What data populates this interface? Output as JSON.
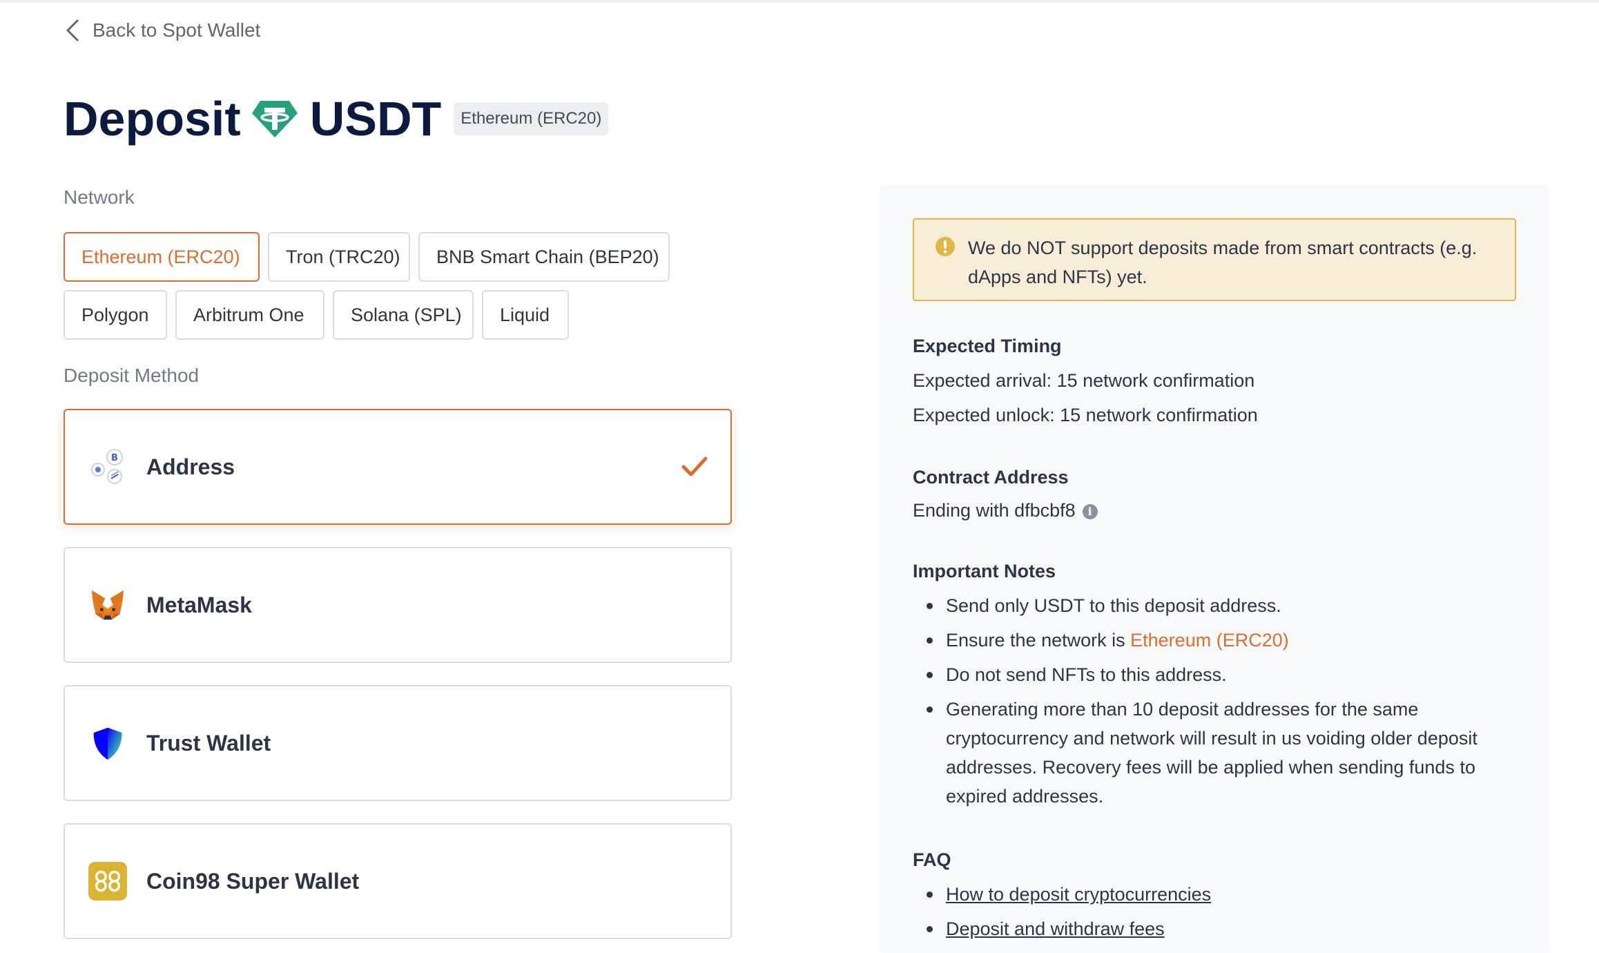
{
  "back": {
    "label": "Back to Spot Wallet"
  },
  "title": {
    "prefix": "Deposit",
    "coin": "USDT",
    "badge": "Ethereum (ERC20)"
  },
  "network": {
    "label": "Network",
    "options": [
      {
        "label": "Ethereum (ERC20)",
        "active": true
      },
      {
        "label": "Tron (TRC20)",
        "active": false
      },
      {
        "label": "BNB Smart Chain (BEP20)",
        "active": false
      },
      {
        "label": "Polygon",
        "active": false
      },
      {
        "label": "Arbitrum One",
        "active": false
      },
      {
        "label": "Solana (SPL)",
        "active": false
      },
      {
        "label": "Liquid",
        "active": false
      }
    ]
  },
  "deposit_method": {
    "label": "Deposit Method",
    "methods": [
      {
        "label": "Address",
        "icon": "address-coins-icon",
        "selected": true
      },
      {
        "label": "MetaMask",
        "icon": "metamask-fox-icon",
        "selected": false
      },
      {
        "label": "Trust Wallet",
        "icon": "trust-wallet-shield-icon",
        "selected": false
      },
      {
        "label": "Coin98 Super Wallet",
        "icon": "coin98-icon",
        "selected": false
      }
    ]
  },
  "panel": {
    "warning": "We do NOT support deposits made from smart contracts (e.g. dApps and NFTs) yet.",
    "timing": {
      "heading": "Expected Timing",
      "arrival": "Expected arrival: 15 network confirmation",
      "unlock": "Expected unlock: 15 network confirmation"
    },
    "contract": {
      "heading": "Contract Address",
      "value": "Ending with dfbcbf8"
    },
    "notes": {
      "heading": "Important Notes",
      "items": [
        "Send only USDT to this deposit address.",
        "Ensure the network is ",
        "Do not send NFTs to this address.",
        "Generating more than 10 deposit addresses for the same cryptocurrency and network will result in us voiding older deposit addresses. Recovery fees will be applied when sending funds to expired addresses."
      ],
      "network_highlight": "Ethereum (ERC20)"
    },
    "faq": {
      "heading": "FAQ",
      "links": [
        "How to deposit cryptocurrencies",
        "Deposit and withdraw fees"
      ]
    }
  },
  "colors": {
    "accent": "#e06c2b",
    "title": "#0b1b3f",
    "warning_bg": "#f8eed8",
    "warning_border": "#e2b645",
    "tether": "#26a17b"
  }
}
